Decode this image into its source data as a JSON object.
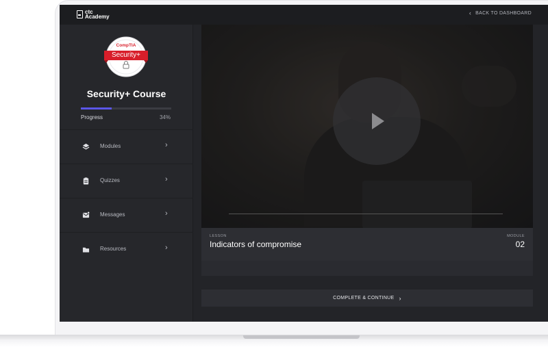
{
  "app": {
    "logo_line1": "ctc",
    "logo_line2": "Academy",
    "back_label": "BACK TO DASHBOARD"
  },
  "badge": {
    "brand": "CompTIA",
    "cert": "Security+"
  },
  "course": {
    "title": "Security+ Course",
    "progress_label": "Progress",
    "progress_percent_text": "34%",
    "progress_value": 0.34
  },
  "sidebar": {
    "items": [
      {
        "label": "Modules",
        "icon": "layers-icon"
      },
      {
        "label": "Quizzes",
        "icon": "clipboard-icon"
      },
      {
        "label": "Messages",
        "icon": "message-icon"
      },
      {
        "label": "Resources",
        "icon": "folder-icon"
      }
    ]
  },
  "lesson": {
    "label": "LESSON",
    "title": "Indicators of compromise",
    "module_label": "MODULE",
    "module_number": "02"
  },
  "actions": {
    "complete_label": "COMPLETE & CONTINUE"
  },
  "colors": {
    "accent": "#5b56e8",
    "badge_red": "#d81e2a"
  }
}
